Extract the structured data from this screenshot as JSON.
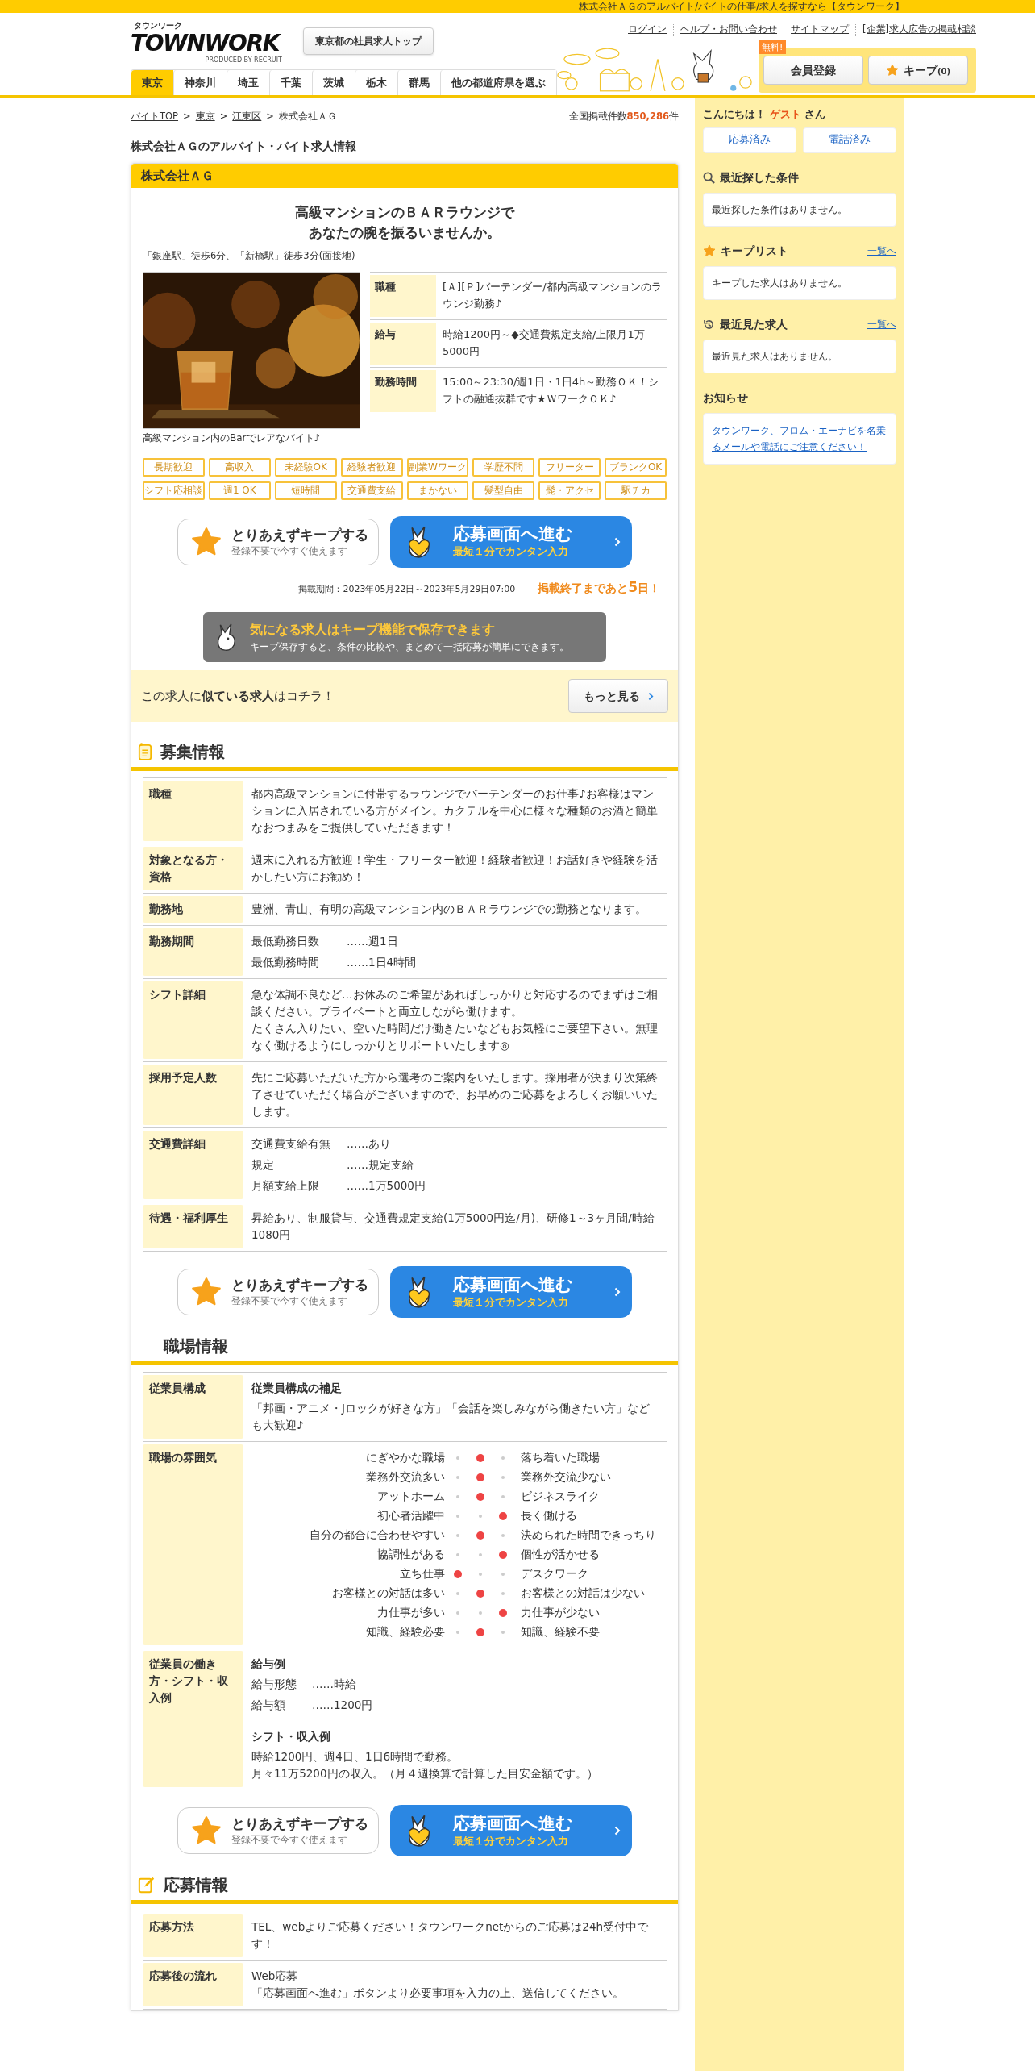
{
  "top_band": "株式会社ＡＧのアルバイト/バイトの仕事/求人を探すなら【タウンワーク】",
  "logo": {
    "kana": "タウンワーク",
    "main": "TOWNWORK",
    "produced": "PRODUCED BY RECRUIT"
  },
  "corporate_button": "東京都の社員求人トップ",
  "header_links": [
    "ログイン",
    "ヘルプ・お問い合わせ",
    "サイトマップ",
    "[企業]求人広告の掲載相談"
  ],
  "member": {
    "badge": "無料!",
    "register": "会員登録",
    "keep": "キープ",
    "keep_count": "(0)"
  },
  "prefecture_tabs": [
    {
      "label": "東京",
      "selected": true
    },
    {
      "label": "神奈川",
      "selected": false
    },
    {
      "label": "埼玉",
      "selected": false
    },
    {
      "label": "千葉",
      "selected": false
    },
    {
      "label": "茨城",
      "selected": false
    },
    {
      "label": "栃木",
      "selected": false
    },
    {
      "label": "群馬",
      "selected": false
    },
    {
      "label": "他の都道府県を選ぶ",
      "selected": false
    }
  ],
  "breadcrumb": {
    "links": [
      "バイトTOP",
      "東京",
      "江東区"
    ],
    "current": "株式会社ＡＧ",
    "separator": ">"
  },
  "total": {
    "prefix": "全国掲載件数",
    "count": "850,286",
    "suffix": "件"
  },
  "page_title": "株式会社ＡＧのアルバイト・バイト求人情報",
  "job": {
    "company": "株式会社ＡＧ",
    "headline": [
      "高級マンションのＢＡＲラウンジで",
      "あなたの腕を振るいませんか。"
    ],
    "access": "「銀座駅」徒歩6分、「新橋駅」徒歩3分(面接地)",
    "photo": {
      "kind": "picture",
      "caption": "高級マンション内のBarでレアなバイト♪"
    },
    "summary": [
      {
        "label": "職種",
        "value": "[Ａ][Ｐ]バーテンダー/都内高級マンションのラウンジ勤務♪"
      },
      {
        "label": "給与",
        "value": "時給1200円～◆交通費規定支給/上限月1万5000円"
      },
      {
        "label": "勤務時間",
        "value": "15:00～23:30/週1日・1日4h～勤務ＯＫ！シフトの融通抜群です★ＷワークＯＫ♪"
      }
    ],
    "tags": [
      "長期歓迎",
      "高収入",
      "未経験OK",
      "経験者歓迎",
      "副業Wワーク",
      "学歴不問",
      "フリーター",
      "ブランクOK",
      "シフト応相談",
      "週1 OK",
      "短時間",
      "交通費支給",
      "まかない",
      "髪型自由",
      "髭・アクセ",
      "駅チカ"
    ]
  },
  "cta_top": {
    "keep": "とりあえずキープする",
    "keep_sub": "登録不要で今すぐ使えます",
    "apply": "応募画面へ進む",
    "apply_sub": "最短１分でカンタン入力"
  },
  "period": "掲載期間：2023年05月22日～2023年5月29日07:00",
  "countdown": {
    "prefix": "掲載終了まであと",
    "days": "5",
    "suffix": "日！"
  },
  "keep_banner": {
    "title": "気になる求人はキープ機能で保存できます",
    "text": "キープ保存すると、条件の比較や、まとめて一括応募が簡単にできます。"
  },
  "similar": {
    "text": "この求人に**似ている求人**はコチラ！",
    "button": "もっと見る"
  },
  "recruit": {
    "title": "募集情報",
    "rows": [
      {
        "kind": "text",
        "label": "職種",
        "paragraphs": [
          "都内高級マンションに付帯するラウンジでバーテンダーのお仕事♪お客様はマンションに入居されている方がメイン。カクテルを中心に様々な種類のお酒と簡単なおつまみをご提供していただきます！"
        ]
      },
      {
        "kind": "text",
        "label": "対象となる方・資格",
        "paragraphs": [
          "週末に入れる方歓迎！学生・フリーター歓迎！経験者歓迎！お話好きや経験を活かしたい方にお勧め！"
        ]
      },
      {
        "kind": "text",
        "label": "勤務地",
        "paragraphs": [
          "豊洲、青山、有明の高級マンション内のＢＡＲラウンジでの勤務となります。"
        ]
      },
      {
        "kind": "pairs",
        "label": "勤務期間",
        "pairs": [
          {
            "name": "最低勤務日数",
            "value": "……週1日"
          },
          {
            "name": "最低勤務時間",
            "value": "……1日4時間"
          }
        ]
      },
      {
        "kind": "text",
        "label": "シフト詳細",
        "paragraphs": [
          "急な体調不良など…お休みのご希望があればしっかりと対応するのでまずはご相談ください。プライベートと両立しながら働けます。",
          "たくさん入りたい、空いた時間だけ働きたいなどもお気軽にご要望下さい。無理なく働けるようにしっかりとサポートいたします◎"
        ]
      },
      {
        "kind": "text",
        "label": "採用予定人数",
        "paragraphs": [
          "先にご応募いただいた方から選考のご案内をいたします。採用者が決まり次第終了させていただく場合がございますので、お早めのご応募をよろしくお願いいたします。"
        ]
      },
      {
        "kind": "pairs",
        "label": "交通費詳細",
        "pairs": [
          {
            "name": "交通費支給有無",
            "value": "……あり"
          },
          {
            "name": "規定",
            "value": "……規定支給"
          },
          {
            "name": "月額支給上限",
            "value": "……1万5000円"
          }
        ]
      },
      {
        "kind": "text",
        "label": "待遇・福利厚生",
        "paragraphs": [
          "昇給あり、制服貸与、交通費規定支給(1万5000円迄/月)、研修1～3ヶ月間/時給1080円"
        ]
      }
    ]
  },
  "cta_middle": {
    "keep": "とりあえずキープする",
    "keep_sub": "登録不要で今すぐ使えます",
    "apply": "応募画面へ進む",
    "apply_sub": "最短１分でカンタン入力"
  },
  "workplace": {
    "title": "職場情報",
    "rows": [
      {
        "kind": "sections",
        "label": "従業員構成",
        "sections": [
          {
            "heading": "従業員構成の補足",
            "paragraphs": [
              "「邦画・アニメ・Jロックが好きな方」「会話を楽しみながら働きたい方」なども大歓迎♪"
            ]
          }
        ]
      },
      {
        "kind": "atmosphere",
        "label": "職場の雰囲気",
        "scales": [
          {
            "left": "にぎやかな職場",
            "right": "落ち着いた職場",
            "dots": [
              {
                "on": false
              },
              {
                "on": true
              },
              {
                "on": false
              }
            ]
          },
          {
            "left": "業務外交流多い",
            "right": "業務外交流少ない",
            "dots": [
              {
                "on": false
              },
              {
                "on": true
              },
              {
                "on": false
              }
            ]
          },
          {
            "left": "アットホーム",
            "right": "ビジネスライク",
            "dots": [
              {
                "on": false
              },
              {
                "on": true
              },
              {
                "on": false
              }
            ]
          },
          {
            "left": "初心者活躍中",
            "right": "長く働ける",
            "dots": [
              {
                "on": false
              },
              {
                "on": false
              },
              {
                "on": true
              }
            ]
          },
          {
            "left": "自分の都合に合わせやすい",
            "right": "決められた時間できっちり",
            "dots": [
              {
                "on": false
              },
              {
                "on": true
              },
              {
                "on": false
              }
            ]
          },
          {
            "left": "協調性がある",
            "right": "個性が活かせる",
            "dots": [
              {
                "on": false
              },
              {
                "on": false
              },
              {
                "on": true
              }
            ]
          },
          {
            "left": "立ち仕事",
            "right": "デスクワーク",
            "dots": [
              {
                "on": true
              },
              {
                "on": false
              },
              {
                "on": false
              }
            ]
          },
          {
            "left": "お客様との対話は多い",
            "right": "お客様との対話は少ない",
            "dots": [
              {
                "on": false
              },
              {
                "on": true
              },
              {
                "on": false
              }
            ]
          },
          {
            "left": "力仕事が多い",
            "right": "力仕事が少ない",
            "dots": [
              {
                "on": false
              },
              {
                "on": false
              },
              {
                "on": true
              }
            ]
          },
          {
            "left": "知識、経験必要",
            "right": "知識、経験不要",
            "dots": [
              {
                "on": false
              },
              {
                "on": true
              },
              {
                "on": false
              }
            ]
          }
        ]
      },
      {
        "kind": "sections",
        "label": "従業員の働き方・シフト・収入例",
        "sections": [
          {
            "heading": "給与例",
            "pairs": [
              {
                "name": "給与形態",
                "value": "……時給"
              },
              {
                "name": "給与額",
                "value": "……1200円"
              }
            ]
          },
          {
            "heading": "シフト・収入例",
            "paragraphs": [
              "時給1200円、週4日、1日6時間で勤務。",
              "月々11万5200円の収入。（月４週換算で計算した目安金額です。）"
            ]
          }
        ]
      }
    ]
  },
  "cta_bottom": {
    "keep": "とりあえずキープする",
    "keep_sub": "登録不要で今すぐ使えます",
    "apply": "応募画面へ進む",
    "apply_sub": "最短１分でカンタン入力"
  },
  "apply_info": {
    "title": "応募情報",
    "rows": [
      {
        "kind": "text",
        "label": "応募方法",
        "paragraphs": [
          "TEL、webよりご応募ください！タウンワークnetからのご応募は24h受付中です！"
        ]
      },
      {
        "kind": "text",
        "label": "応募後の流れ",
        "paragraphs": [
          "Web応募",
          "「応募画面へ進む」ボタンより必要事項を入力の上、送信してください。"
        ]
      }
    ]
  },
  "sidebar": {
    "greeting": "こんにちは！",
    "guest": "ゲスト",
    "honorific": "さん",
    "history_links": [
      "応募済み",
      "電話済み"
    ],
    "sections": [
      {
        "kind": "search",
        "title": "最近探した条件",
        "text": "最近探した条件はありません。"
      },
      {
        "kind": "keep",
        "title": "キープリスト",
        "link": "一覧へ",
        "text": "キープした求人はありません。"
      },
      {
        "kind": "history",
        "title": "最近見た求人",
        "link": "一覧へ",
        "text": "最近見た求人はありません。"
      },
      {
        "kind": "notice",
        "title": "お知らせ",
        "link_text": "タウンワーク、フロム・エーナビを名乗るメールや電話にご注意ください！"
      }
    ]
  }
}
